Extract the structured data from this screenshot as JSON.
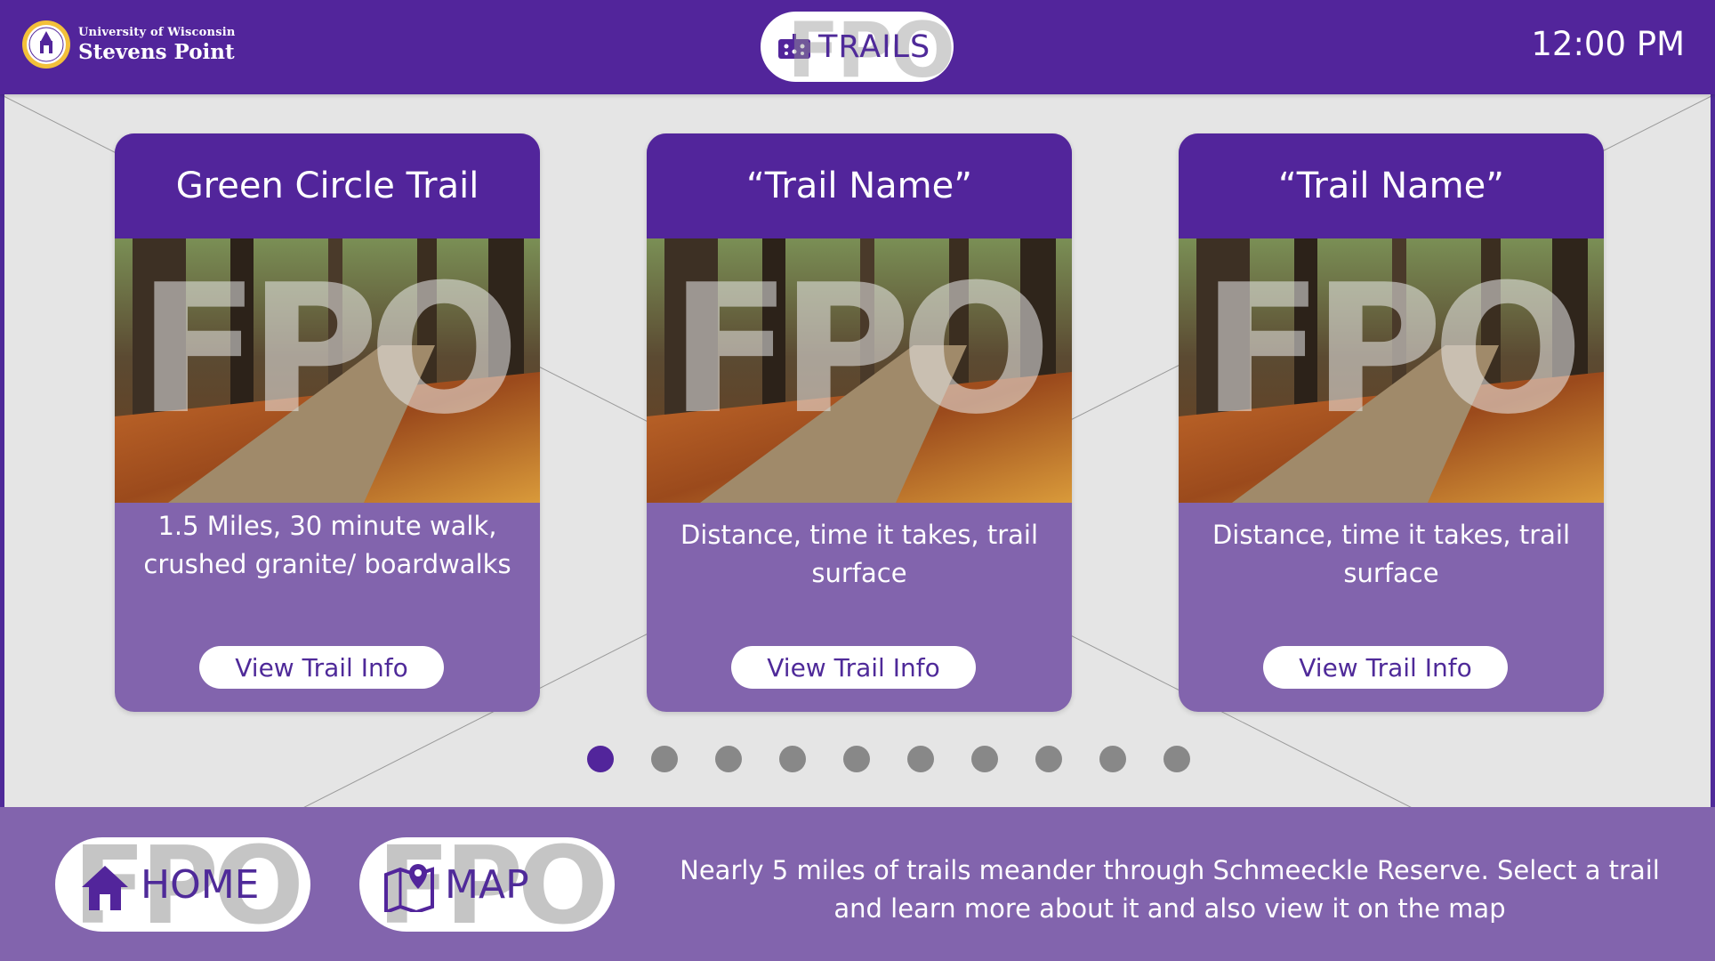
{
  "header": {
    "logo_line1": "University of Wisconsin",
    "logo_line2": "Stevens Point",
    "section_title": "TRAILS",
    "watermark": "FPO",
    "time": "12:00 PM"
  },
  "cards": [
    {
      "title": "Green Circle Trail",
      "watermark": "FPO",
      "description": "1.5 Miles,  30 minute walk, crushed granite/ boardwalks",
      "button": "View Trail Info"
    },
    {
      "title": "“Trail Name”",
      "watermark": "FPO",
      "description": "Distance, time it takes, trail surface",
      "button": "View Trail Info"
    },
    {
      "title": "“Trail Name”",
      "watermark": "FPO",
      "description": "Distance, time it takes, trail surface",
      "button": "View Trail Info"
    }
  ],
  "pagination": {
    "total": 10,
    "active_index": 1
  },
  "footer": {
    "home_label": "HOME",
    "map_label": "MAP",
    "watermark": "FPO",
    "description": "Nearly 5 miles of trails meander through Schmeeckle Reserve. Select a trail and learn more about it and also view it on the map"
  },
  "colors": {
    "primary": "#52259b",
    "secondary": "#8264ad",
    "background": "#e5e5e5",
    "dot_inactive": "#888888"
  },
  "icons": {
    "header_pill": "trail-sign-icon",
    "home": "house-icon",
    "map": "map-pin-icon",
    "logo": "university-seal"
  }
}
